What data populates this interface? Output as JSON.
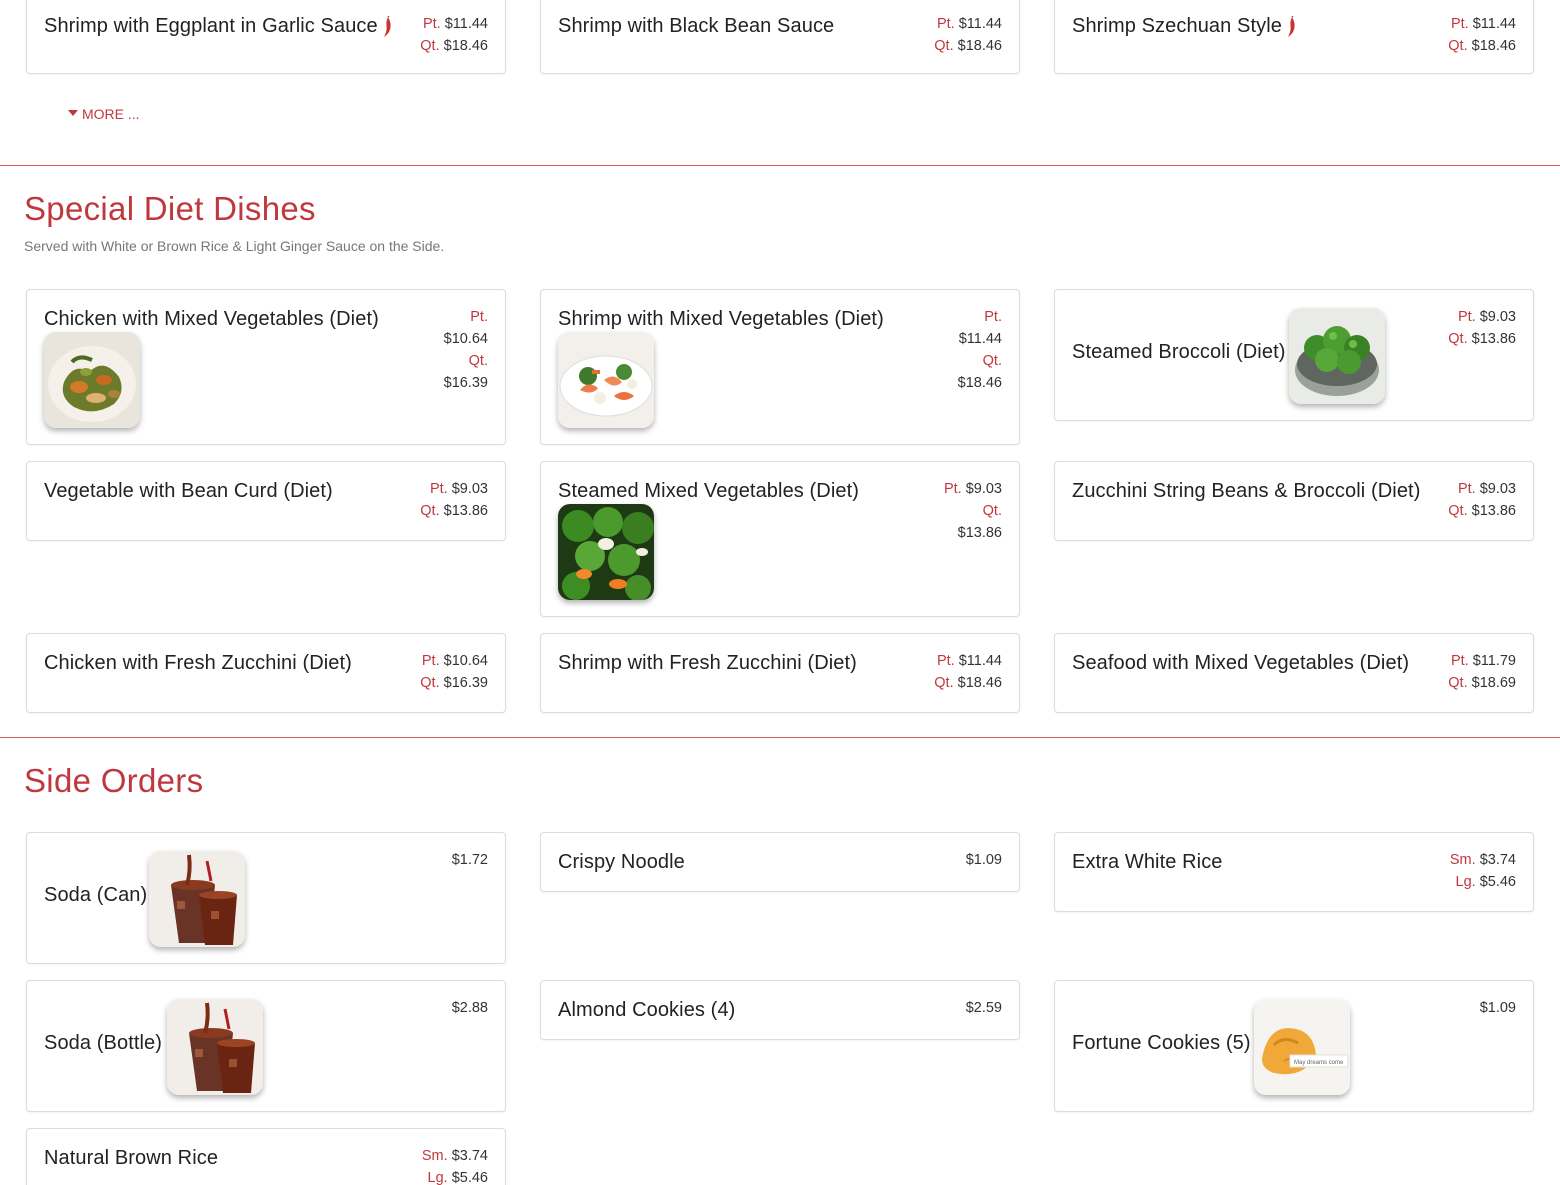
{
  "top_items": [
    {
      "name": "Shrimp with Eggplant in Garlic Sauce",
      "spicy": true,
      "prices": [
        {
          "label": "Pt.",
          "value": "$11.44"
        },
        {
          "label": "Qt.",
          "value": "$18.46"
        }
      ]
    },
    {
      "name": "Shrimp with Black Bean Sauce",
      "spicy": false,
      "prices": [
        {
          "label": "Pt.",
          "value": "$11.44"
        },
        {
          "label": "Qt.",
          "value": "$18.46"
        }
      ]
    },
    {
      "name": "Shrimp Szechuan Style",
      "spicy": true,
      "prices": [
        {
          "label": "Pt.",
          "value": "$11.44"
        },
        {
          "label": "Qt.",
          "value": "$18.46"
        }
      ]
    }
  ],
  "more_label": "MORE ...",
  "diet_section": {
    "title": "Special Diet Dishes",
    "subtitle": "Served with White or Brown Rice & Light Ginger Sauce on the Side.",
    "items": [
      {
        "name": "Chicken with Mixed Vegetables (Diet)",
        "pt": "$10.64",
        "qt": "$16.39",
        "image": "chicken-veg-photo"
      },
      {
        "name": "Shrimp with Mixed Vegetables (Diet)",
        "pt": "$11.44",
        "qt": "$18.46",
        "image": "shrimp-veg-photo"
      },
      {
        "name": "Steamed Broccoli (Diet)",
        "pt": "$9.03",
        "qt": "$13.86",
        "image": "broccoli-photo"
      },
      {
        "name": "Vegetable with Bean Curd (Diet)",
        "pt": "$9.03",
        "qt": "$13.86"
      },
      {
        "name": "Steamed Mixed Vegetables (Diet)",
        "pt": "$9.03",
        "qt": "$13.86",
        "image": "mixed-veg-photo"
      },
      {
        "name": "Zucchini String Beans & Broccoli (Diet)",
        "pt": "$9.03",
        "qt": "$13.86"
      },
      {
        "name": "Chicken with Fresh Zucchini (Diet)",
        "pt": "$10.64",
        "qt": "$16.39"
      },
      {
        "name": "Shrimp with Fresh Zucchini (Diet)",
        "pt": "$11.44",
        "qt": "$18.46"
      },
      {
        "name": "Seafood with Mixed Vegetables (Diet)",
        "pt": "$11.79",
        "qt": "$18.69"
      }
    ],
    "pt_label": "Pt.",
    "qt_label": "Qt."
  },
  "side_section": {
    "title": "Side Orders",
    "items": [
      {
        "name": "Soda (Can)",
        "price": "$1.72",
        "image": "soda-photo"
      },
      {
        "name": "Crispy Noodle",
        "price": "$1.09"
      },
      {
        "name": "Extra White Rice",
        "sm": "$3.74",
        "lg": "$5.46"
      },
      {
        "name": "Soda (Bottle)",
        "price": "$2.88",
        "image": "soda-photo"
      },
      {
        "name": "Almond Cookies (4)",
        "price": "$2.59"
      },
      {
        "name": "Fortune Cookies (5)",
        "price": "$1.09",
        "image": "fortune-cookie-photo",
        "image_text": "May dreams come"
      },
      {
        "name": "Natural Brown Rice",
        "sm": "$3.74",
        "lg": "$5.46"
      }
    ],
    "sm_label": "Sm.",
    "lg_label": "Lg."
  },
  "colors": {
    "accent": "#c0383f",
    "divider": "#d7575e",
    "border": "#dcdcdc"
  }
}
